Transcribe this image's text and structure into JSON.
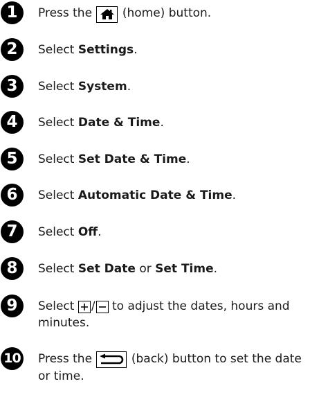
{
  "steps": [
    {
      "num": "1",
      "parts": {
        "a": "Press the ",
        "b": " (home) button."
      },
      "icons": {
        "home": "home-icon"
      }
    },
    {
      "num": "2",
      "parts": {
        "a": "Select ",
        "b": "Settings",
        "c": "."
      }
    },
    {
      "num": "3",
      "parts": {
        "a": "Select ",
        "b": "System",
        "c": "."
      }
    },
    {
      "num": "4",
      "parts": {
        "a": "Select ",
        "b": "Date & Time",
        "c": "."
      }
    },
    {
      "num": "5",
      "parts": {
        "a": "Select ",
        "b": "Set Date & Time",
        "c": "."
      }
    },
    {
      "num": "6",
      "parts": {
        "a": "Select ",
        "b": "Automatic Date & Time",
        "c": "."
      }
    },
    {
      "num": "7",
      "parts": {
        "a": "Select ",
        "b": "Off",
        "c": "."
      }
    },
    {
      "num": "8",
      "parts": {
        "a": "Select ",
        "b": "Set Date",
        "c": " or ",
        "d": "Set Time",
        "e": "."
      }
    },
    {
      "num": "9",
      "parts": {
        "a": "Select ",
        "slash": "/",
        "b": " to adjust the dates, hours and minutes."
      },
      "icons": {
        "plus": "plus-icon",
        "minus": "minus-icon"
      }
    },
    {
      "num": "10",
      "parts": {
        "a": "Press the ",
        "b": " (back) button to set the date or time."
      },
      "icons": {
        "back": "back-arrow-icon"
      }
    }
  ]
}
